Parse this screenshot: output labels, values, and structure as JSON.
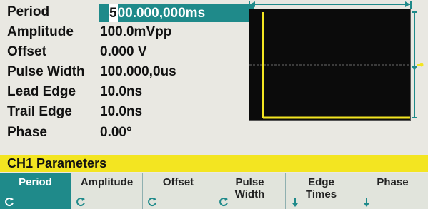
{
  "params": {
    "period": {
      "label": "Period",
      "value_a": "5",
      "value_b": "00.000,000ms"
    },
    "amplitude": {
      "label": "Amplitude",
      "value": "100.0mVpp"
    },
    "offset": {
      "label": "Offset",
      "value": "0.000 V"
    },
    "pulse_width": {
      "label": "Pulse Width",
      "value": "100.000,0us"
    },
    "lead_edge": {
      "label": "Lead Edge",
      "value": "10.0ns"
    },
    "trail_edge": {
      "label": "Trail Edge",
      "value": "10.0ns"
    },
    "phase": {
      "label": "Phase",
      "value": "0.00°"
    }
  },
  "header": {
    "title": "CH1  Parameters"
  },
  "softkeys": [
    {
      "line1": "Period",
      "line2": "",
      "icon": "rotate-knob-icon"
    },
    {
      "line1": "Amplitude",
      "line2": "",
      "icon": "rotate-knob-icon"
    },
    {
      "line1": "Offset",
      "line2": "",
      "icon": "rotate-knob-icon"
    },
    {
      "line1": "Pulse",
      "line2": "Width",
      "icon": "rotate-knob-icon"
    },
    {
      "line1": "Edge",
      "line2": "Times",
      "icon": "arrow-down-icon"
    },
    {
      "line1": "Phase",
      "line2": "",
      "icon": "arrow-down-icon"
    }
  ],
  "colors": {
    "accent": "#1f8a8a",
    "ch1": "#f3e521"
  }
}
